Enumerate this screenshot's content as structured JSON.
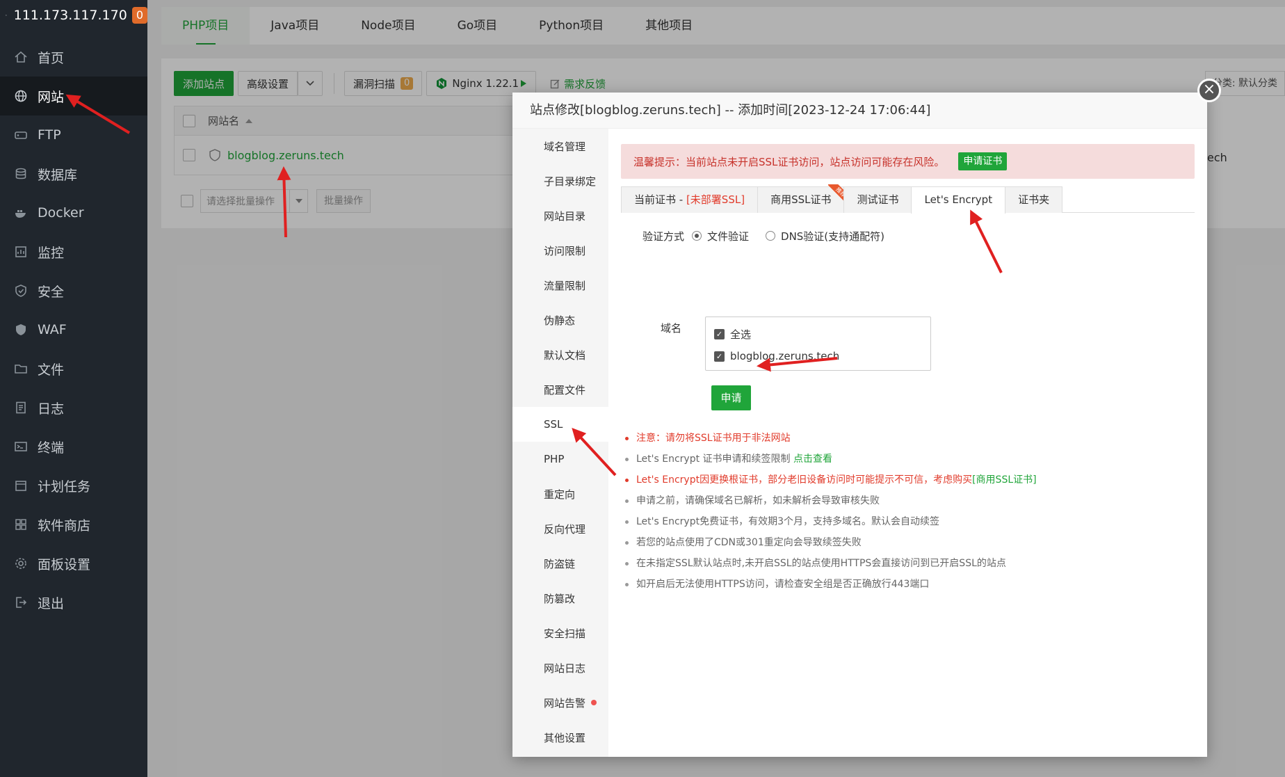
{
  "sidebar": {
    "ip": "111.173.117.170",
    "badge": "0",
    "items": [
      {
        "label": "首页",
        "icon": "home-icon"
      },
      {
        "label": "网站",
        "icon": "globe-icon"
      },
      {
        "label": "FTP",
        "icon": "ftp-icon"
      },
      {
        "label": "数据库",
        "icon": "database-icon"
      },
      {
        "label": "Docker",
        "icon": "docker-icon"
      },
      {
        "label": "监控",
        "icon": "monitor-icon"
      },
      {
        "label": "安全",
        "icon": "shield-icon"
      },
      {
        "label": "WAF",
        "icon": "waf-icon"
      },
      {
        "label": "文件",
        "icon": "folder-icon"
      },
      {
        "label": "日志",
        "icon": "log-icon"
      },
      {
        "label": "终端",
        "icon": "terminal-icon"
      },
      {
        "label": "计划任务",
        "icon": "calendar-icon"
      },
      {
        "label": "软件商店",
        "icon": "apps-icon"
      },
      {
        "label": "面板设置",
        "icon": "gear-icon"
      },
      {
        "label": "退出",
        "icon": "logout-icon"
      }
    ]
  },
  "tabs": [
    "PHP项目",
    "Java项目",
    "Node项目",
    "Go项目",
    "Python项目",
    "其他项目"
  ],
  "toolbar": {
    "add_site": "添加站点",
    "advanced": "高级设置",
    "vuln_scan": "漏洞扫描",
    "vuln_count": "0",
    "nginx": "Nginx 1.22.1",
    "feedback": "需求反馈",
    "category": "分类: 默认分类"
  },
  "table": {
    "col_site": "网站名",
    "site": "blogblog.zeruns.tech",
    "partial_right": "ech"
  },
  "batch": {
    "select": "请选择批量操作",
    "button": "批量操作"
  },
  "modal": {
    "title": "站点修改[blogblog.zeruns.tech] -- 添加时间[2023-12-24 17:06:44]",
    "close": "×",
    "nav": [
      "域名管理",
      "子目录绑定",
      "网站目录",
      "访问限制",
      "流量限制",
      "伪静态",
      "默认文档",
      "配置文件",
      "SSL",
      "PHP",
      "重定向",
      "反向代理",
      "防盗链",
      "防篡改",
      "安全扫描",
      "网站日志",
      "网站告警",
      "其他设置"
    ],
    "warning": "温馨提示：当前站点未开启SSL证书访问，站点访问可能存在风险。",
    "apply_cert": "申请证书",
    "cert_tabs": {
      "current": "当前证书 - ",
      "current_status": "[未部署SSL]",
      "commercial": "商用SSL证书",
      "ribbon": "推荐",
      "test": "测试证书",
      "letsencrypt": "Let's Encrypt",
      "folder": "证书夹"
    },
    "verify_label": "验证方式",
    "verify_file": "文件验证",
    "verify_dns": "DNS验证(支持通配符)",
    "domain_label": "域名",
    "select_all": "全选",
    "domain": "blogblog.zeruns.tech",
    "submit": "申请",
    "tips": {
      "t1": "注意：请勿将SSL证书用于非法网站",
      "t2": "Let's Encrypt 证书申请和续签限制 ",
      "t2_link": "点击查看",
      "t3": "Let's Encrypt因更换根证书，部分老旧设备访问时可能提示不可信，考虑购买",
      "t3_link": "[商用SSL证书]",
      "t4": "申请之前，请确保域名已解析，如未解析会导致审核失败",
      "t5": "Let's Encrypt免费证书，有效期3个月，支持多域名。默认会自动续签",
      "t6": "若您的站点使用了CDN或301重定向会导致续签失败",
      "t7": "在未指定SSL默认站点时,未开启SSL的站点使用HTTPS会直接访问到已开启SSL的站点",
      "t8": "如开启后无法使用HTTPS访问，请检查安全组是否正确放行443端口"
    }
  },
  "colors": {
    "accent": "#20a53a",
    "sidebar": "#20262d",
    "warning_bg": "#f5dcdc",
    "danger": "#e13b2b",
    "arrow": "#e02020"
  }
}
